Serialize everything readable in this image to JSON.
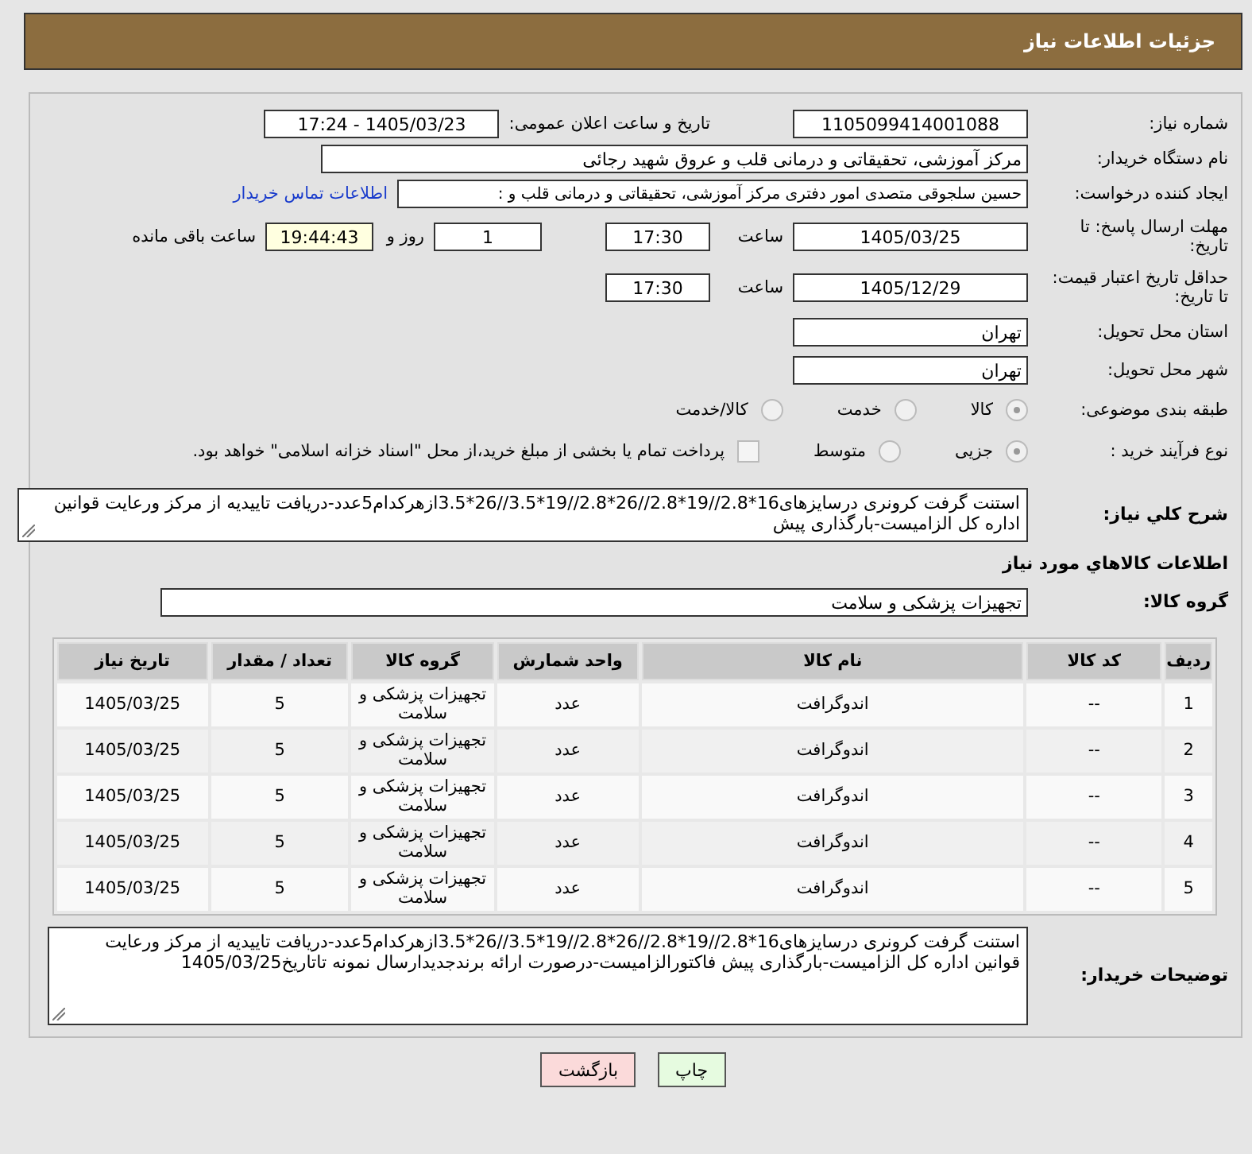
{
  "header": {
    "title": "جزئیات اطلاعات نیاز"
  },
  "need_number": {
    "label": "شماره نیاز:",
    "value": "1105099414001088"
  },
  "announce": {
    "label": "تاریخ و ساعت اعلان عمومی:",
    "value": "1405/03/23 - 17:24"
  },
  "buyer_org": {
    "label": "نام دستگاه خریدار:",
    "value": "مرکز آموزشی، تحقیقاتی و درمانی قلب و عروق شهید رجائی"
  },
  "requester": {
    "label": "ایجاد کننده درخواست:",
    "value": "حسین سلجوقی متصدی امور دفتری مرکز آموزشی، تحقیقاتی و درمانی قلب و :",
    "link": "اطلاعات تماس خریدار"
  },
  "reply_deadline": {
    "label": "مهلت ارسال پاسخ: تا تاریخ:",
    "date": "1405/03/25",
    "time_label": "ساعت",
    "time": "17:30",
    "days": "1",
    "days_label": "روز و",
    "remaining": "19:44:43",
    "remaining_label": "ساعت باقی مانده"
  },
  "price_validity": {
    "label": "حداقل تاریخ اعتبار قیمت: تا تاریخ:",
    "date": "1405/12/29",
    "time_label": "ساعت",
    "time": "17:30"
  },
  "province": {
    "label": "استان محل تحویل:",
    "value": "تهران"
  },
  "city": {
    "label": "شهر محل تحویل:",
    "value": "تهران"
  },
  "category": {
    "label": "طبقه بندی موضوعی:",
    "options": [
      {
        "label": "کالا",
        "selected": true
      },
      {
        "label": "خدمت",
        "selected": false
      },
      {
        "label": "کالا/خدمت",
        "selected": false
      }
    ]
  },
  "purchase_type": {
    "label": "نوع فرآیند خرید :",
    "options": [
      {
        "label": "جزیی",
        "selected": true
      },
      {
        "label": "متوسط",
        "selected": false
      }
    ],
    "payment": {
      "checked": false,
      "text": "پرداخت تمام یا بخشی از مبلغ خرید،از محل \"اسناد خزانه اسلامی\" خواهد بود."
    }
  },
  "summary": {
    "label": "شرح کلي نياز:",
    "value": "استنت گرفت کرونری درسایزهای16*2.8//19*2.8//26*2.8//19*3.5//26*3.5ازهرکدام5عدد-دریافت تاییدیه از مرکز ورعایت قوانین اداره کل الزامیست-بارگذاری پیش"
  },
  "goods_section": {
    "title": "اطلاعات کالاهاي مورد نياز"
  },
  "goods_group": {
    "label": "گروه کالا:",
    "value": "تجهیزات پزشکی و سلامت"
  },
  "table": {
    "columns": [
      "ردیف",
      "کد کالا",
      "نام کالا",
      "واحد شمارش",
      "گروه کالا",
      "تعداد / مقدار",
      "تاریخ نیاز"
    ],
    "rows": [
      [
        "1",
        "--",
        "اندوگرافت",
        "عدد",
        "تجهیزات پزشکی و سلامت",
        "5",
        "1405/03/25"
      ],
      [
        "2",
        "--",
        "اندوگرافت",
        "عدد",
        "تجهیزات پزشکی و سلامت",
        "5",
        "1405/03/25"
      ],
      [
        "3",
        "--",
        "اندوگرافت",
        "عدد",
        "تجهیزات پزشکی و سلامت",
        "5",
        "1405/03/25"
      ],
      [
        "4",
        "--",
        "اندوگرافت",
        "عدد",
        "تجهیزات پزشکی و سلامت",
        "5",
        "1405/03/25"
      ],
      [
        "5",
        "--",
        "اندوگرافت",
        "عدد",
        "تجهیزات پزشکی و سلامت",
        "5",
        "1405/03/25"
      ]
    ]
  },
  "buyer_notes": {
    "label": "توضیحات خریدار:",
    "value": "استنت گرفت کرونری درسایزهای16*2.8//19*2.8//26*2.8//19*3.5//26*3.5ازهرکدام5عدد-دریافت تاییدیه از مرکز ورعایت قوانین اداره کل الزامیست-بارگذاری پیش فاکتورالزامیست-درصورت ارائه برندجدیدارسال نمونه تاتاریخ1405/03/25"
  },
  "buttons": [
    {
      "label": "چاپ",
      "kind": "print"
    },
    {
      "label": "بازگشت",
      "kind": "back"
    }
  ]
}
